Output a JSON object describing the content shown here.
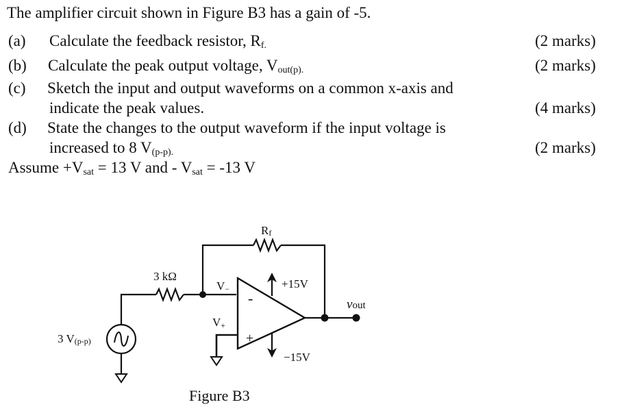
{
  "question": {
    "intro": "The amplifier circuit shown in Figure B3 has a gain of -5.",
    "parts": [
      {
        "label": "(a)",
        "text": "Calculate the feedback resistor, R",
        "sub": "f.",
        "marks": "(2 marks)"
      },
      {
        "label": "(b)",
        "text": "Calculate the peak output voltage, V",
        "sub": "out(p).",
        "marks": "(2 marks)"
      },
      {
        "label": "(c)",
        "text_line1": "Sketch the input and output waveforms on a common x-axis and",
        "text_line2": "indicate the peak values.",
        "marks": "(4 marks)"
      },
      {
        "label": "(d)",
        "text_line1": "State the changes to the output waveform if the input voltage is",
        "text_line2": "increased to 8 V",
        "sub": "(p-p).",
        "marks": "(2 marks)"
      }
    ],
    "assume": {
      "pre": "Assume +V",
      "sub1": "sat",
      "mid": " = 13 V and - V",
      "sub2": "sat",
      "post": " = -13 V"
    }
  },
  "figure": {
    "caption": "Figure B3",
    "rf_label": "R",
    "rf_sub": "f",
    "rin_label": "3 kΩ",
    "source_label": "3 V",
    "source_sub": "(p-p)",
    "vminus_label": "V",
    "vminus_sub": "−",
    "vplus_label": "V",
    "vplus_sub": "+",
    "pos_supply": "+15V",
    "neg_supply": "−15V",
    "vout_label": "v",
    "vout_sub": "out",
    "inv_sign": "-",
    "noninv_sign": "+"
  }
}
